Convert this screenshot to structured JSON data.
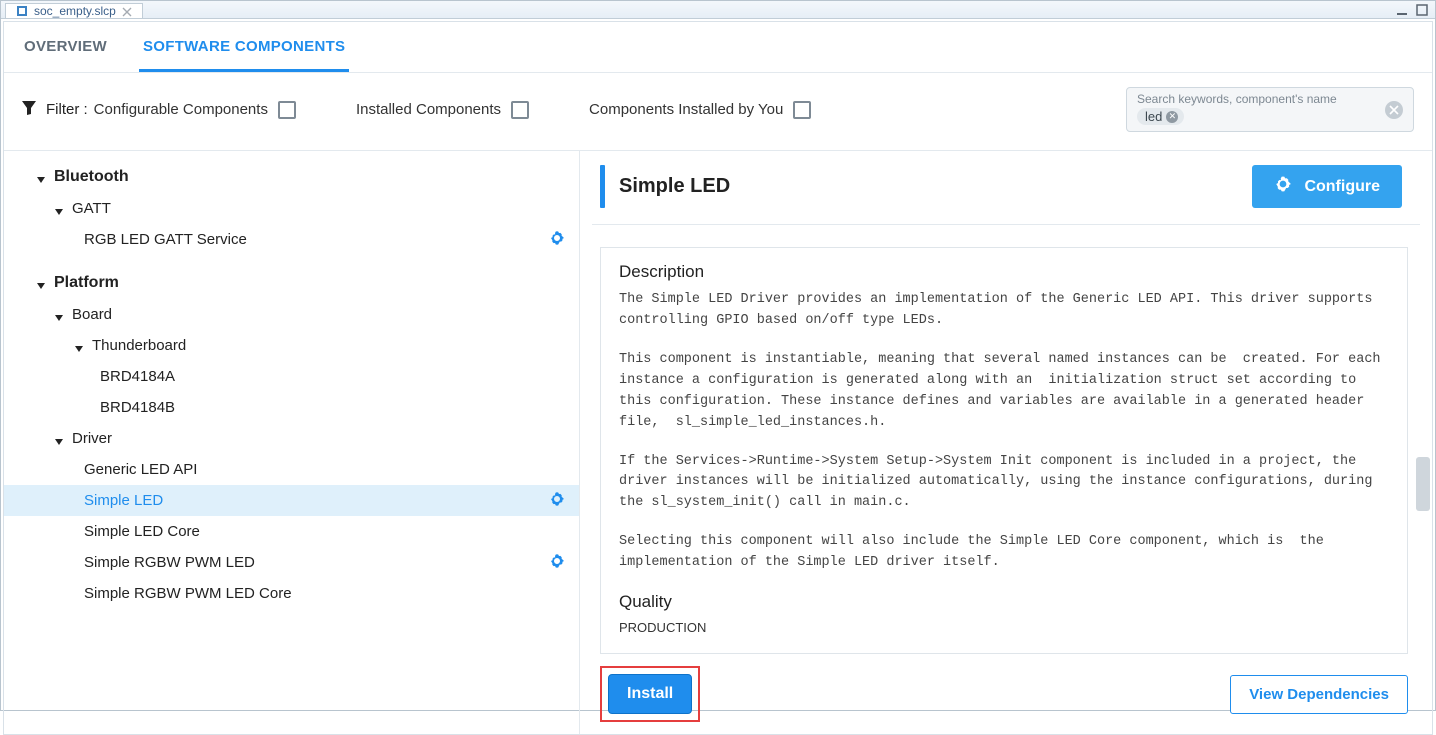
{
  "window": {
    "file_tab": "soc_empty.slcp"
  },
  "tabs": {
    "overview": "OVERVIEW",
    "software_components": "SOFTWARE COMPONENTS"
  },
  "filter": {
    "label": "Filter :",
    "configurable": "Configurable Components",
    "installed": "Installed Components",
    "by_you": "Components Installed by You"
  },
  "search": {
    "placeholder": "Search keywords, component's name",
    "chip": "led"
  },
  "tree": {
    "bluetooth": "Bluetooth",
    "gatt": "GATT",
    "rgb_gatt": "RGB LED GATT Service",
    "platform": "Platform",
    "board": "Board",
    "thunderboard": "Thunderboard",
    "brd4184a": "BRD4184A",
    "brd4184b": "BRD4184B",
    "driver": "Driver",
    "generic_led_api": "Generic LED API",
    "simple_led": "Simple LED",
    "simple_led_core": "Simple LED Core",
    "simple_rgbw_pwm_led": "Simple RGBW PWM LED",
    "simple_rgbw_pwm_led_core": "Simple RGBW PWM LED Core"
  },
  "detail": {
    "title": "Simple LED",
    "configure": "Configure",
    "desc_heading": "Description",
    "desc_p1": "The Simple LED Driver provides an implementation of the Generic LED API. This driver supports controlling GPIO based on/off type LEDs.",
    "desc_p2": "This component is instantiable, meaning that several named instances can be  created. For each instance a configuration is generated along with an  initialization struct set according to this configuration. These instance defines and variables are available in a generated header file,  sl_simple_led_instances.h.",
    "desc_p3": "If the Services->Runtime->System Setup->System Init component is included in a project, the driver instances will be initialized automatically, using the instance configurations, during the sl_system_init() call in main.c.",
    "desc_p4": "Selecting this component will also include the Simple LED Core component, which is  the implementation of the Simple LED driver itself.",
    "quality_heading": "Quality",
    "quality_value": "PRODUCTION",
    "install": "Install",
    "view_deps": "View Dependencies"
  }
}
